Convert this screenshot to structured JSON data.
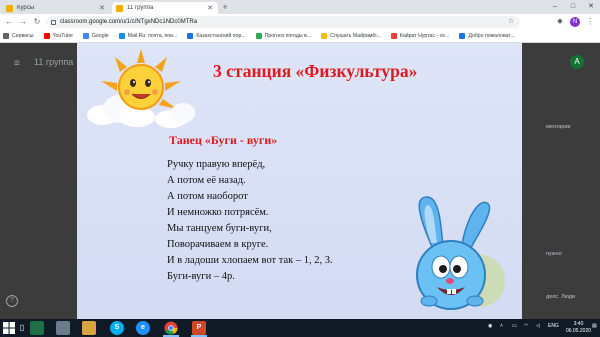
{
  "browser": {
    "tabs": [
      {
        "title": "Курсы",
        "icon": "classroom-icon",
        "icon_color": "#f9ab00",
        "active": false
      },
      {
        "title": "11 группа",
        "icon": "classroom-icon",
        "icon_color": "#f9ab00",
        "active": true
      }
    ],
    "new_tab": "+",
    "window_controls": {
      "minimize": "–",
      "maximize": "□",
      "close": "✕"
    },
    "nav": {
      "back": "←",
      "forward": "→",
      "reload": "↻"
    },
    "url": "classroom.google.com/u/1/c/NTgxNDc1NDc0MTRa",
    "profile_letter": "N",
    "menu": "⋮",
    "bookmark_star": "☆",
    "extension": "◆"
  },
  "bookmarks": [
    {
      "label": "Сервисы",
      "icon": "apps-icon",
      "color": "#5f6368"
    },
    {
      "label": "YouTube",
      "icon": "youtube-icon",
      "color": "#ff0000"
    },
    {
      "label": "Google",
      "icon": "google-icon",
      "color": "#4285f4"
    },
    {
      "label": "Mail.Ru: почта, пои...",
      "icon": "mailru-icon",
      "color": "#168de2"
    },
    {
      "label": "Казахстанский пор...",
      "icon": "portal-icon",
      "color": "#1a73e8"
    },
    {
      "label": "Прогноз погоды в...",
      "icon": "weather-icon",
      "color": "#34a853"
    },
    {
      "label": "Слушать Майрамбі...",
      "icon": "music-icon",
      "color": "#fbbc04"
    },
    {
      "label": "Кайрат Нуртас - се...",
      "icon": "music-icon",
      "color": "#ea4335"
    },
    {
      "label": "Добро пожаловат...",
      "icon": "welcome-icon",
      "color": "#1a73e8"
    }
  ],
  "classroom": {
    "menu_icon": "≡",
    "title": "11 группа",
    "gear": "⚙",
    "avatar_letter": "A",
    "help": "?",
    "side_snippets": [
      "ментарии",
      "нужно",
      "делс. Люди"
    ]
  },
  "slide": {
    "title": "3 станция «Физкультура»",
    "dance_title": "Танец «Буги - вуги»",
    "poem": [
      " Ручку правую вперёд,",
      "А потом её назад.",
      "А потом наоборот",
      "И немножко потрясём.",
      "Мы танцуем буги-вуги,",
      "Поворачиваем в круге.",
      "И в ладоши хлопаем вот так – 1, 2, 3.",
      "Буги-вуги – 4р."
    ],
    "colors": {
      "title": "#e0191f",
      "background": "#d8dff5"
    }
  },
  "taskbar": {
    "apps": [
      {
        "label": "",
        "icon": "excel-icon",
        "color": "#1d7044"
      },
      {
        "label": "",
        "icon": "photos-icon",
        "color": "#6b7b8c"
      },
      {
        "label": "",
        "icon": "folder-icon",
        "color": "#d9a441"
      },
      {
        "label": "S",
        "icon": "skype-icon",
        "color": "#00aff0"
      },
      {
        "label": "e",
        "icon": "edge-icon",
        "color": "#1e90ff"
      },
      {
        "label": "",
        "icon": "chrome-icon",
        "color": "#ffffff"
      },
      {
        "label": "P",
        "icon": "powerpoint-icon",
        "color": "#d24726"
      }
    ],
    "tray": {
      "language": "ENG"
    },
    "clock": {
      "time": "3:40",
      "date": "06.05.2020"
    }
  }
}
